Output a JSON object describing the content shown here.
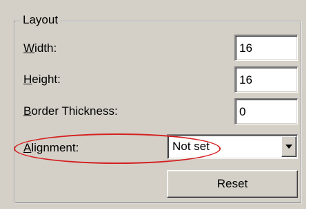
{
  "group": {
    "title": "Layout"
  },
  "fields": {
    "width": {
      "label_mnemonic": "W",
      "label_rest": "idth:",
      "value": "16"
    },
    "height": {
      "label_mnemonic": "H",
      "label_rest": "eight:",
      "value": "16"
    },
    "border_thickness": {
      "label_mnemonic": "B",
      "label_rest": "order Thickness:",
      "value": "0"
    },
    "alignment": {
      "label_mnemonic": "A",
      "label_rest": "lignment:",
      "value": "Not set",
      "dropdown_icon": "chevron-down-icon"
    }
  },
  "buttons": {
    "reset_label": "Reset"
  },
  "annotation": {
    "highlight_color": "#d42020"
  },
  "colors": {
    "panel_background": "#d4d0c8",
    "field_background": "#ffffff"
  }
}
